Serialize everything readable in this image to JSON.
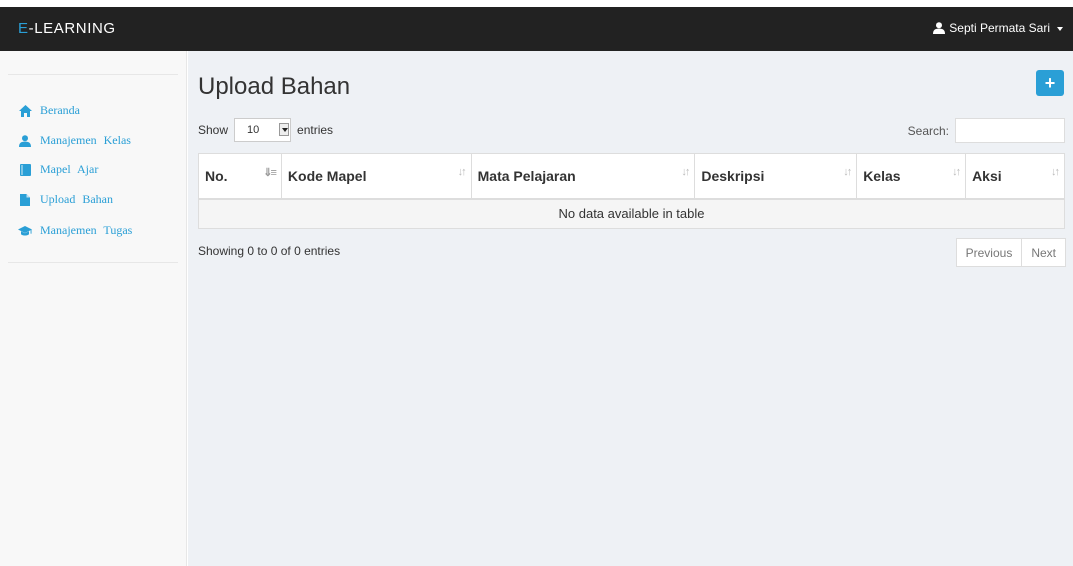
{
  "brand": {
    "prefix": "E",
    "rest": "-LEARNING"
  },
  "user": {
    "name": "Septi Permata Sari"
  },
  "sidebar": {
    "items": [
      {
        "label": "Beranda",
        "icon": "home-icon"
      },
      {
        "label": "Manajemen  Kelas",
        "icon": "user-icon"
      },
      {
        "label": "Mapel  Ajar",
        "icon": "book-icon"
      },
      {
        "label": "Upload  Bahan",
        "icon": "file-icon"
      },
      {
        "label": "Manajemen  Tugas",
        "icon": "graduation-cap-icon"
      }
    ]
  },
  "main": {
    "title": "Upload Bahan",
    "add_label": "+",
    "length": {
      "show": "Show",
      "value": "10",
      "entries": "entries"
    },
    "search": {
      "label": "Search:",
      "value": ""
    },
    "table": {
      "columns": [
        "No.",
        "Kode Mapel",
        "Mata Pelajaran",
        "Deskripsi",
        "Kelas",
        "Aksi"
      ],
      "empty": "No data available in table"
    },
    "info": "Showing 0 to 0 of 0 entries",
    "pagination": {
      "previous": "Previous",
      "next": "Next"
    }
  },
  "colors": {
    "accent": "#2a9fd6",
    "navbar": "#222222",
    "content_bg": "#eef1f5"
  }
}
